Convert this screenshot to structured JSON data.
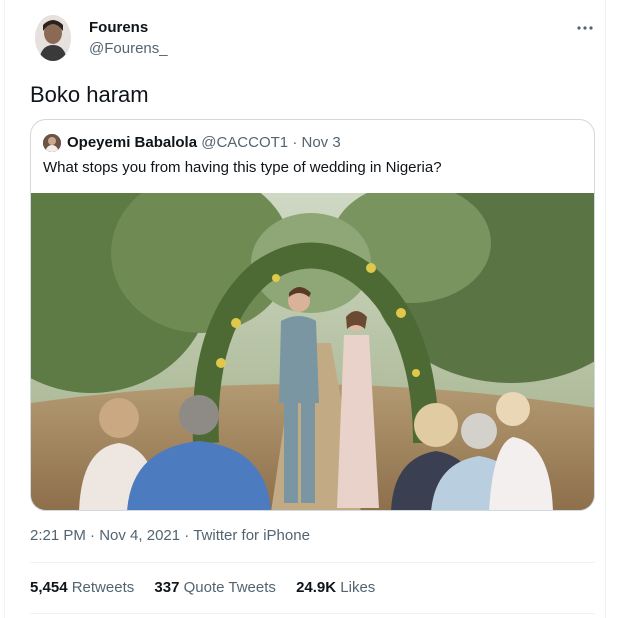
{
  "author": {
    "name": "Fourens",
    "handle": "@Fourens_"
  },
  "tweet": {
    "text": "Boko haram",
    "time": "2:21 PM",
    "date": "Nov 4, 2021",
    "source": "Twitter for iPhone"
  },
  "quoted": {
    "name": "Opeyemi Babalola",
    "handle": "@CACCOT1",
    "date": "Nov 3",
    "text": "What stops you from having this type of wedding in Nigeria?"
  },
  "stats": {
    "retweets_count": "5,454",
    "retweets_label": "Retweets",
    "quotes_count": "337",
    "quotes_label": "Quote Tweets",
    "likes_count": "24.9K",
    "likes_label": "Likes"
  },
  "icons": {
    "more": "more-horizontal-icon"
  },
  "colors": {
    "text": "#0f1419",
    "secondary": "#536471",
    "border": "#cfd9de"
  }
}
